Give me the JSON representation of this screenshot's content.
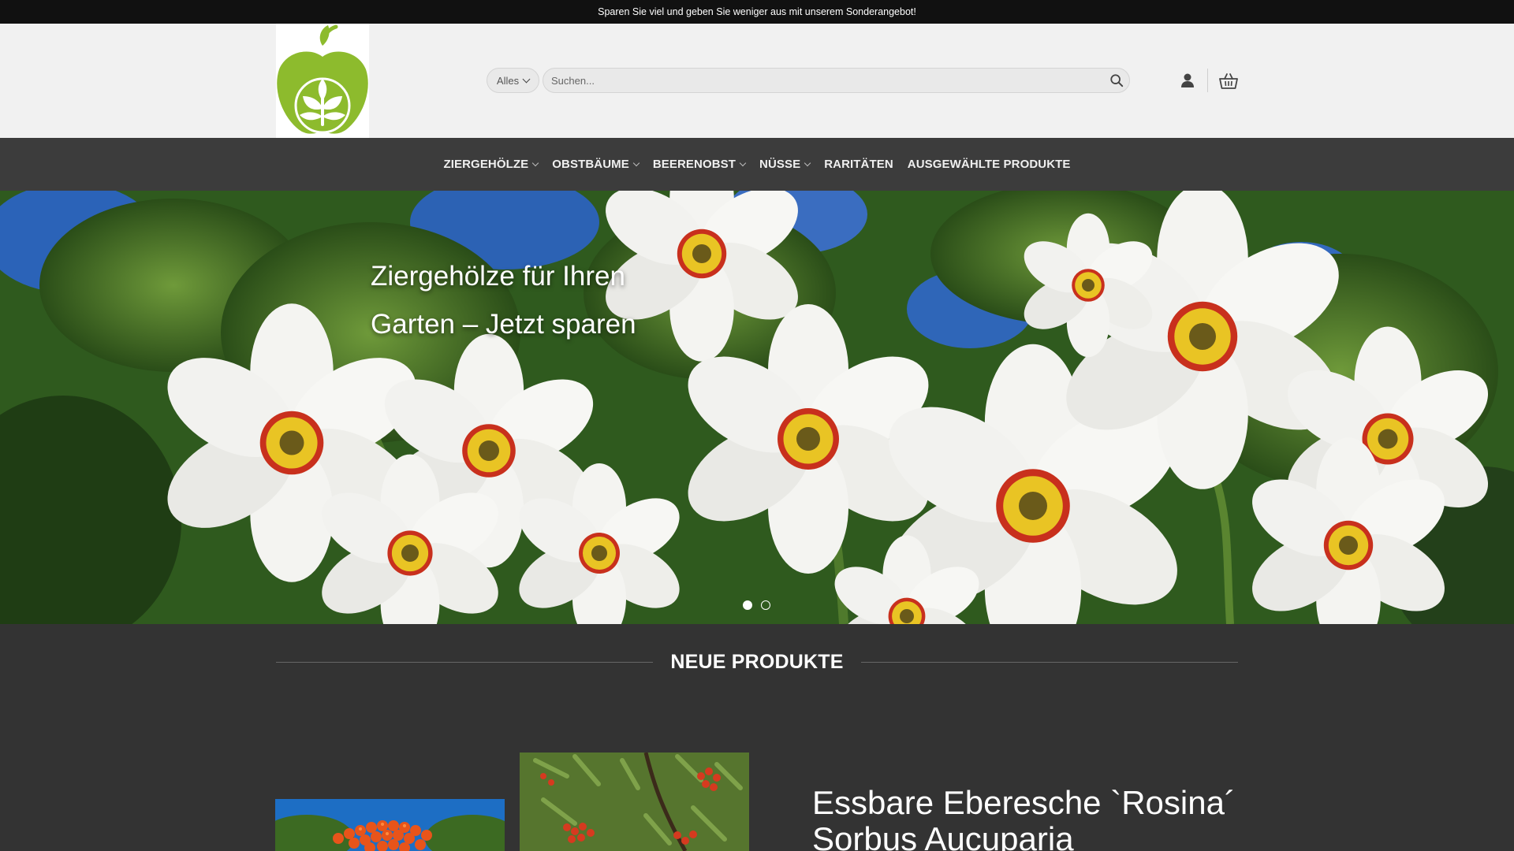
{
  "announcement": {
    "text": "Sparen Sie viel und geben Sie weniger aus mit unserem Sonderangebot!"
  },
  "header": {
    "logo_icon": "apple-tree-logo",
    "search": {
      "category_label": "Alles",
      "placeholder": "Suchen...",
      "value": ""
    },
    "icons": {
      "account": "user-icon",
      "cart": "cart-icon",
      "search": "search-icon"
    }
  },
  "nav": {
    "items": [
      {
        "label": "ZIERGEHÖLZE",
        "has_dropdown": true
      },
      {
        "label": "OBSTBÄUME",
        "has_dropdown": true
      },
      {
        "label": "BEERENOBST",
        "has_dropdown": true
      },
      {
        "label": "NÜSSE",
        "has_dropdown": true
      },
      {
        "label": "RARITÄTEN",
        "has_dropdown": false
      },
      {
        "label": "AUSGEWÄHLTE PRODUKTE",
        "has_dropdown": false
      }
    ]
  },
  "hero": {
    "headline_line1": "Ziergehölze für Ihren",
    "headline_line2": "Garten – Jetzt sparen",
    "slide_count": 2,
    "active_slide": 1
  },
  "section": {
    "title": "NEUE PRODUKTE"
  },
  "product": {
    "title_line1": "Essbare Eberesche `Rosina´",
    "title_line2": "Sorbus Aucuparia"
  },
  "colors": {
    "accent_green": "#8dbb2d",
    "nav_bg": "#3c3c3c",
    "page_bg": "#333333",
    "topbar_bg": "#111111",
    "header_bg": "#f1f1f1"
  }
}
